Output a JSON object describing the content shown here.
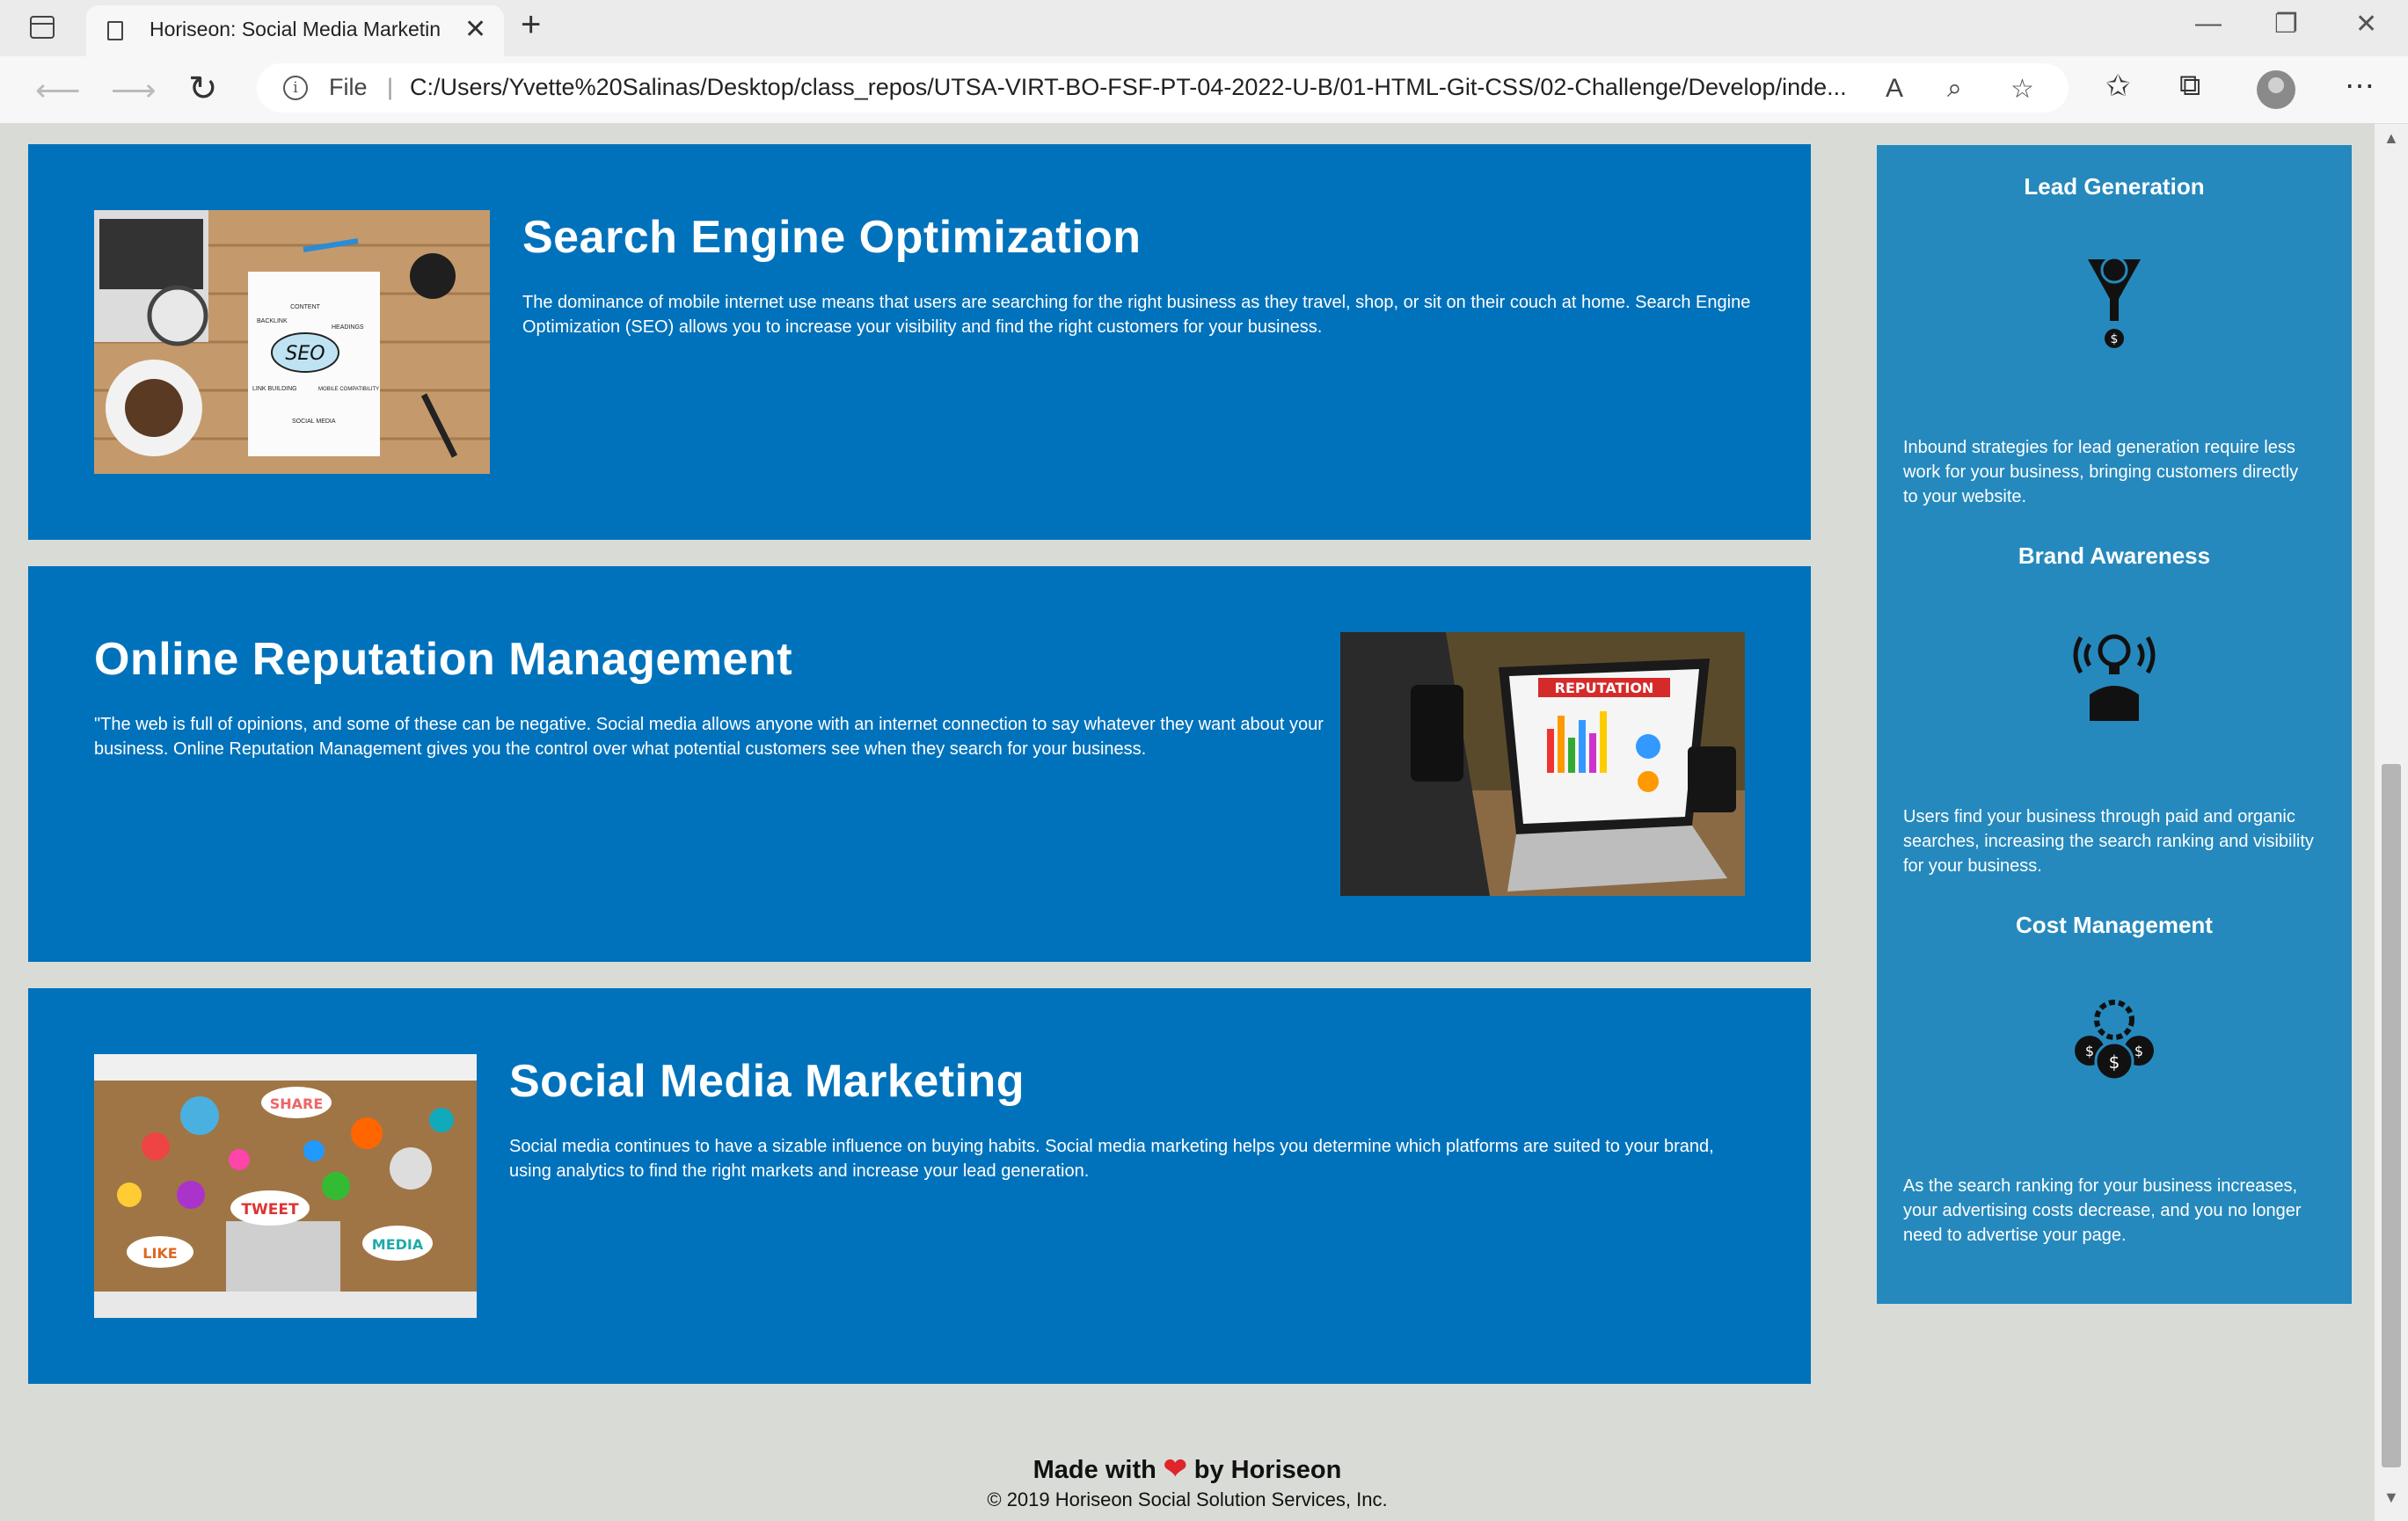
{
  "browser": {
    "tab_title": "Horiseon: Social Media Marketin",
    "tab_close": "✕",
    "new_tab": "+",
    "file_label": "File",
    "url": "C:/Users/Yvette%20Salinas/Desktop/class_repos/UTSA-VIRT-BO-FSF-PT-04-2022-U-B/01-HTML-Git-CSS/02-Challenge/Develop/inde..."
  },
  "services": [
    {
      "title": "Search Engine Optimization",
      "text": "The dominance of mobile internet use means that users are searching for the right business as they travel, shop, or sit on their couch at home. Search Engine Optimization (SEO) allows you to increase your visibility and find the right customers for your business."
    },
    {
      "title": "Online Reputation Management",
      "text": "\"The web is full of opinions, and some of these can be negative. Social media allows anyone with an internet connection to say whatever they want about your business. Online Reputation Management gives you the control over what potential customers see when they search for your business."
    },
    {
      "title": "Social Media Marketing",
      "text": "Social media continues to have a sizable influence on buying habits. Social media marketing helps you determine which platforms are suited to your brand, using analytics to find the right markets and increase your lead generation."
    }
  ],
  "image_text": {
    "seo": {
      "center": "SEO",
      "content": "CONTENT",
      "backlink": "BACKLINK",
      "headings": "HEADINGS",
      "link_building": "LINK BUILDING",
      "mobile": "MOBILE COMPATIBILITY",
      "social": "SOCIAL MEDIA"
    },
    "reputation": {
      "banner": "REPUTATION"
    },
    "social": {
      "share": "SHARE",
      "tweet": "TWEET",
      "like": "LIKE",
      "media": "MEDIA"
    }
  },
  "benefits": [
    {
      "title": "Lead Generation",
      "text": "Inbound strategies for lead generation require less work for your business, bringing customers directly to your website.",
      "icon": "lead-generation-icon"
    },
    {
      "title": "Brand Awareness",
      "text": "Users find your business through paid and organic searches, increasing the search ranking and visibility for your business.",
      "icon": "brand-awareness-icon"
    },
    {
      "title": "Cost Management",
      "text": "As the search ranking for your business increases, your advertising costs decrease, and you no longer need to advertise your page.",
      "icon": "cost-management-icon"
    }
  ],
  "footer": {
    "made_with": "Made with",
    "heart": "❤",
    "by": "by Horiseon",
    "copyright": "© 2019 Horiseon Social Solution Services, Inc."
  },
  "colors": {
    "card_bg": "#0072bb",
    "aside_bg": "#2589bd",
    "page_bg": "#d9dcd6",
    "heart": "#e0242b"
  }
}
